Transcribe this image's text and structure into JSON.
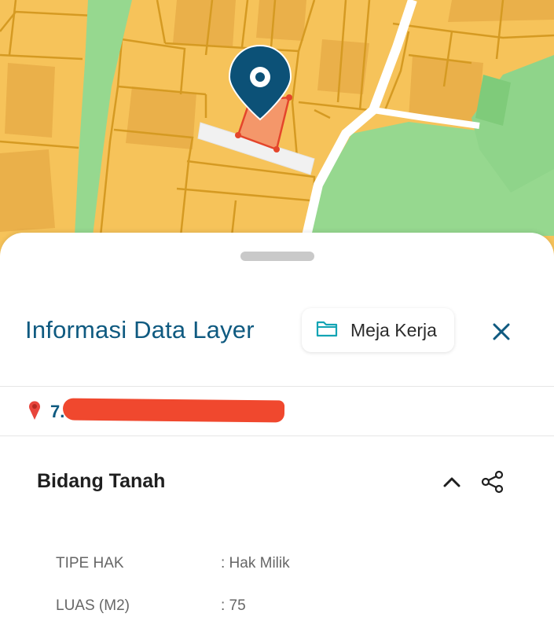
{
  "map": {
    "colors": {
      "parcel": "#f6c35a",
      "parcel_dark": "#e8a93a",
      "parcel_border": "#d9a128",
      "green": "#96d88f",
      "green_dark": "#7fcb7a",
      "road": "#ffffff",
      "selected": "#f4976a",
      "selected_border": "#e4452b",
      "marker": "#0c5177"
    },
    "icons": {
      "marker": "location-pin-icon"
    }
  },
  "panel": {
    "title": "Informasi Data Layer",
    "workspace_label": "Meja Kerja",
    "workspace_icon": "folder-icon",
    "close_icon": "close-icon",
    "coordinates": {
      "icon": "pin-icon",
      "visible_text": "7.7"
    },
    "section": {
      "title": "Bidang Tanah",
      "collapse_icon": "chevron-up-icon",
      "share_icon": "share-icon",
      "attributes": [
        {
          "key": "TIPE HAK",
          "value": ": Hak Milik"
        },
        {
          "key": "LUAS (M2)",
          "value": ": 75"
        }
      ]
    },
    "colors": {
      "title": "#0f5a80",
      "accent": "#13a4b4",
      "redaction": "#f0482e"
    }
  }
}
